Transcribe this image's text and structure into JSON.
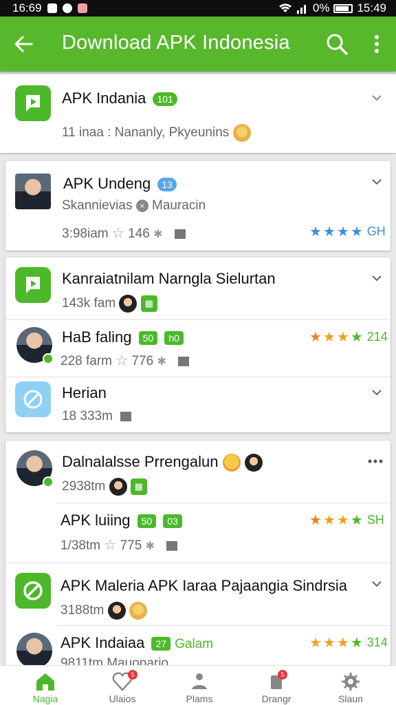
{
  "status_bar": {
    "time_left": "16:69",
    "battery": "0%",
    "time_right": "15:49"
  },
  "app_bar": {
    "title": "Download APK Indonesia",
    "back_icon": "arrow-left-icon",
    "search_icon": "search-icon",
    "more_icon": "more-vert-icon"
  },
  "cards": [
    {
      "title": "APK Indania",
      "tag": "101",
      "meta": "11 inaa : Nananly, Pkyeunins"
    },
    {
      "title": "APK Undeng",
      "tag": "13",
      "meta": "Skannievias",
      "meta2": "Mauracin",
      "sub": "3:98iam",
      "count": "146",
      "rating": "GH"
    },
    {
      "rows": [
        {
          "title": "Kanraiatnilam Narngla Sielurtan",
          "meta": "143k fam"
        },
        {
          "title": "HaB faling",
          "tag1": "50",
          "tag2": "h0",
          "meta": "228 farm",
          "count": "776",
          "rating": "214"
        },
        {
          "title": "Herian",
          "meta": "18 333m"
        }
      ]
    },
    {
      "rows": [
        {
          "title": "Dalnalalsse Prrengalun",
          "meta": "2938tm"
        },
        {
          "title": "APK luiing",
          "tag1": "50",
          "tag2": "03",
          "meta": "1/38tm",
          "count": "775",
          "rating": "SH"
        },
        {
          "title": "APK Maleria APK Iaraa Pajaangia Sindrsia",
          "meta": "3188tm"
        },
        {
          "title": "APK Indaiaa",
          "tag1": "27",
          "tag_text": "Galam",
          "meta": "9811tm",
          "meta2": "Mauopario",
          "rating": "314"
        }
      ]
    }
  ],
  "bottom_nav": [
    {
      "label": "Nagia",
      "icon": "home-icon",
      "active": true
    },
    {
      "label": "Ulaios",
      "icon": "heart-icon",
      "badge": "5"
    },
    {
      "label": "Plams",
      "icon": "person-icon"
    },
    {
      "label": "Drangr",
      "icon": "download-icon",
      "badge": "5"
    },
    {
      "label": "Slaun",
      "icon": "gear-icon"
    }
  ],
  "colors": {
    "primary": "#58b82c",
    "star_blue": "#3d8fd8",
    "star_orange": "#f0a020",
    "badge_red": "#e53935"
  }
}
